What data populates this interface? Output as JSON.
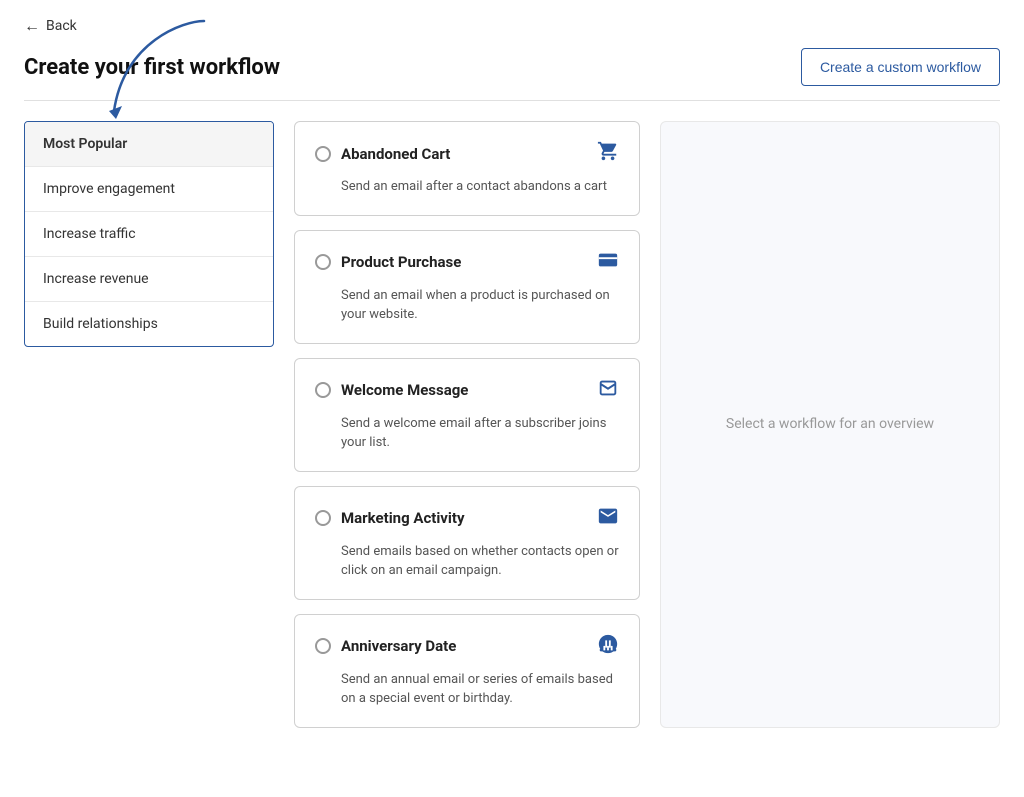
{
  "back": {
    "label": "Back",
    "arrow": "←"
  },
  "header": {
    "title": "Create your first workflow",
    "create_button": "Create a custom workflow"
  },
  "sidebar": {
    "items": [
      {
        "id": "most-popular",
        "label": "Most Popular",
        "active": true
      },
      {
        "id": "improve-engagement",
        "label": "Improve engagement",
        "active": false
      },
      {
        "id": "increase-traffic",
        "label": "Increase traffic",
        "active": false
      },
      {
        "id": "increase-revenue",
        "label": "Increase revenue",
        "active": false
      },
      {
        "id": "build-relationships",
        "label": "Build relationships",
        "active": false
      }
    ]
  },
  "workflows": [
    {
      "id": "abandoned-cart",
      "title": "Abandoned Cart",
      "description": "Send an email after a contact abandons a cart",
      "icon": "🛒"
    },
    {
      "id": "product-purchase",
      "title": "Product Purchase",
      "description": "Send an email when a product is purchased on your website.",
      "icon": "💳"
    },
    {
      "id": "welcome-message",
      "title": "Welcome Message",
      "description": "Send a welcome email after a subscriber joins your list.",
      "icon": "🤝"
    },
    {
      "id": "marketing-activity",
      "title": "Marketing Activity",
      "description": "Send emails based on whether contacts open or click on an email campaign.",
      "icon": "✉️"
    },
    {
      "id": "anniversary-date",
      "title": "Anniversary Date",
      "description": "Send an annual email or series of emails based on a special event or birthday.",
      "icon": "🎂"
    }
  ],
  "preview": {
    "placeholder": "Select a workflow for an overview"
  }
}
